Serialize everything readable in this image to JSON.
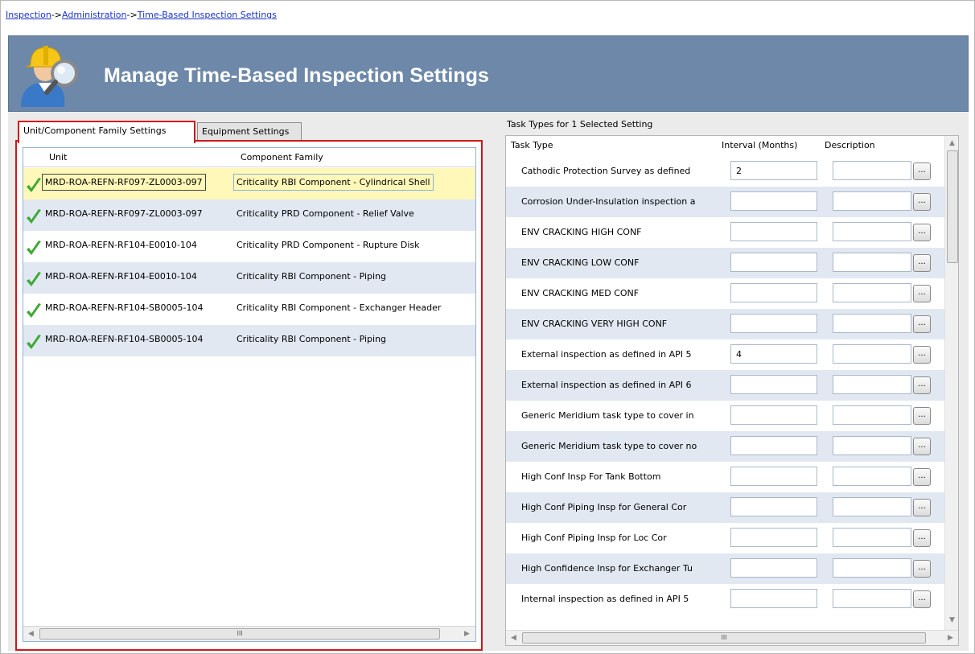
{
  "breadcrumb": {
    "items": [
      "Inspection",
      "Administration",
      "Time-Based Inspection Settings"
    ],
    "separator": "->"
  },
  "header": {
    "title": "Manage Time-Based Inspection Settings",
    "icon": "inspector-magnifier-icon"
  },
  "tabs": [
    {
      "label": "Unit/Component Family Settings",
      "active": true
    },
    {
      "label": "Equipment Settings",
      "active": false
    }
  ],
  "left_grid": {
    "columns": [
      "Unit",
      "Component Family"
    ],
    "rows": [
      {
        "unit": "MRD-ROA-REFN-RF097-ZL0003-097",
        "family": "Criticality RBI Component - Cylindrical Shell",
        "selected": true
      },
      {
        "unit": "MRD-ROA-REFN-RF097-ZL0003-097",
        "family": "Criticality PRD Component - Relief Valve"
      },
      {
        "unit": "MRD-ROA-REFN-RF104-E0010-104",
        "family": "Criticality PRD Component - Rupture Disk"
      },
      {
        "unit": "MRD-ROA-REFN-RF104-E0010-104",
        "family": "Criticality RBI Component - Piping"
      },
      {
        "unit": "MRD-ROA-REFN-RF104-SB0005-104",
        "family": "Criticality RBI Component - Exchanger Header"
      },
      {
        "unit": "MRD-ROA-REFN-RF104-SB0005-104",
        "family": "Criticality RBI Component - Piping"
      }
    ],
    "scroll_thumb": "III"
  },
  "right_grid": {
    "title": "Task Types for 1 Selected Setting",
    "columns": [
      "Task Type",
      "Interval (Months)",
      "Description"
    ],
    "ellipsis": "...",
    "scroll_thumb": "III",
    "rows": [
      {
        "task": "Cathodic Protection Survey as defined",
        "interval": "2"
      },
      {
        "task": "Corrosion Under-Insulation inspection a",
        "interval": ""
      },
      {
        "task": "ENV CRACKING  HIGH CONF",
        "interval": ""
      },
      {
        "task": "ENV CRACKING  LOW CONF",
        "interval": ""
      },
      {
        "task": "ENV CRACKING  MED CONF",
        "interval": ""
      },
      {
        "task": "ENV CRACKING VERY HIGH CONF",
        "interval": ""
      },
      {
        "task": "External inspection as defined in API 5",
        "interval": "4"
      },
      {
        "task": "External inspection as defined in API 6",
        "interval": ""
      },
      {
        "task": "Generic Meridium task type to cover in",
        "interval": ""
      },
      {
        "task": "Generic Meridium task type to cover no",
        "interval": ""
      },
      {
        "task": "High Conf Insp For Tank Bottom",
        "interval": ""
      },
      {
        "task": "High Conf Piping Insp for General Cor",
        "interval": ""
      },
      {
        "task": "High Conf Piping Insp for Loc Cor",
        "interval": ""
      },
      {
        "task": "High Confidence Insp for Exchanger Tu",
        "interval": ""
      },
      {
        "task": "Internal inspection as defined in API 5",
        "interval": ""
      }
    ]
  },
  "colors": {
    "header_bg": "#6d88a8",
    "highlight_border": "#d01818",
    "row_alt": "#e1e8f2",
    "row_selected": "#fff8b8",
    "check": "#3fa935"
  }
}
